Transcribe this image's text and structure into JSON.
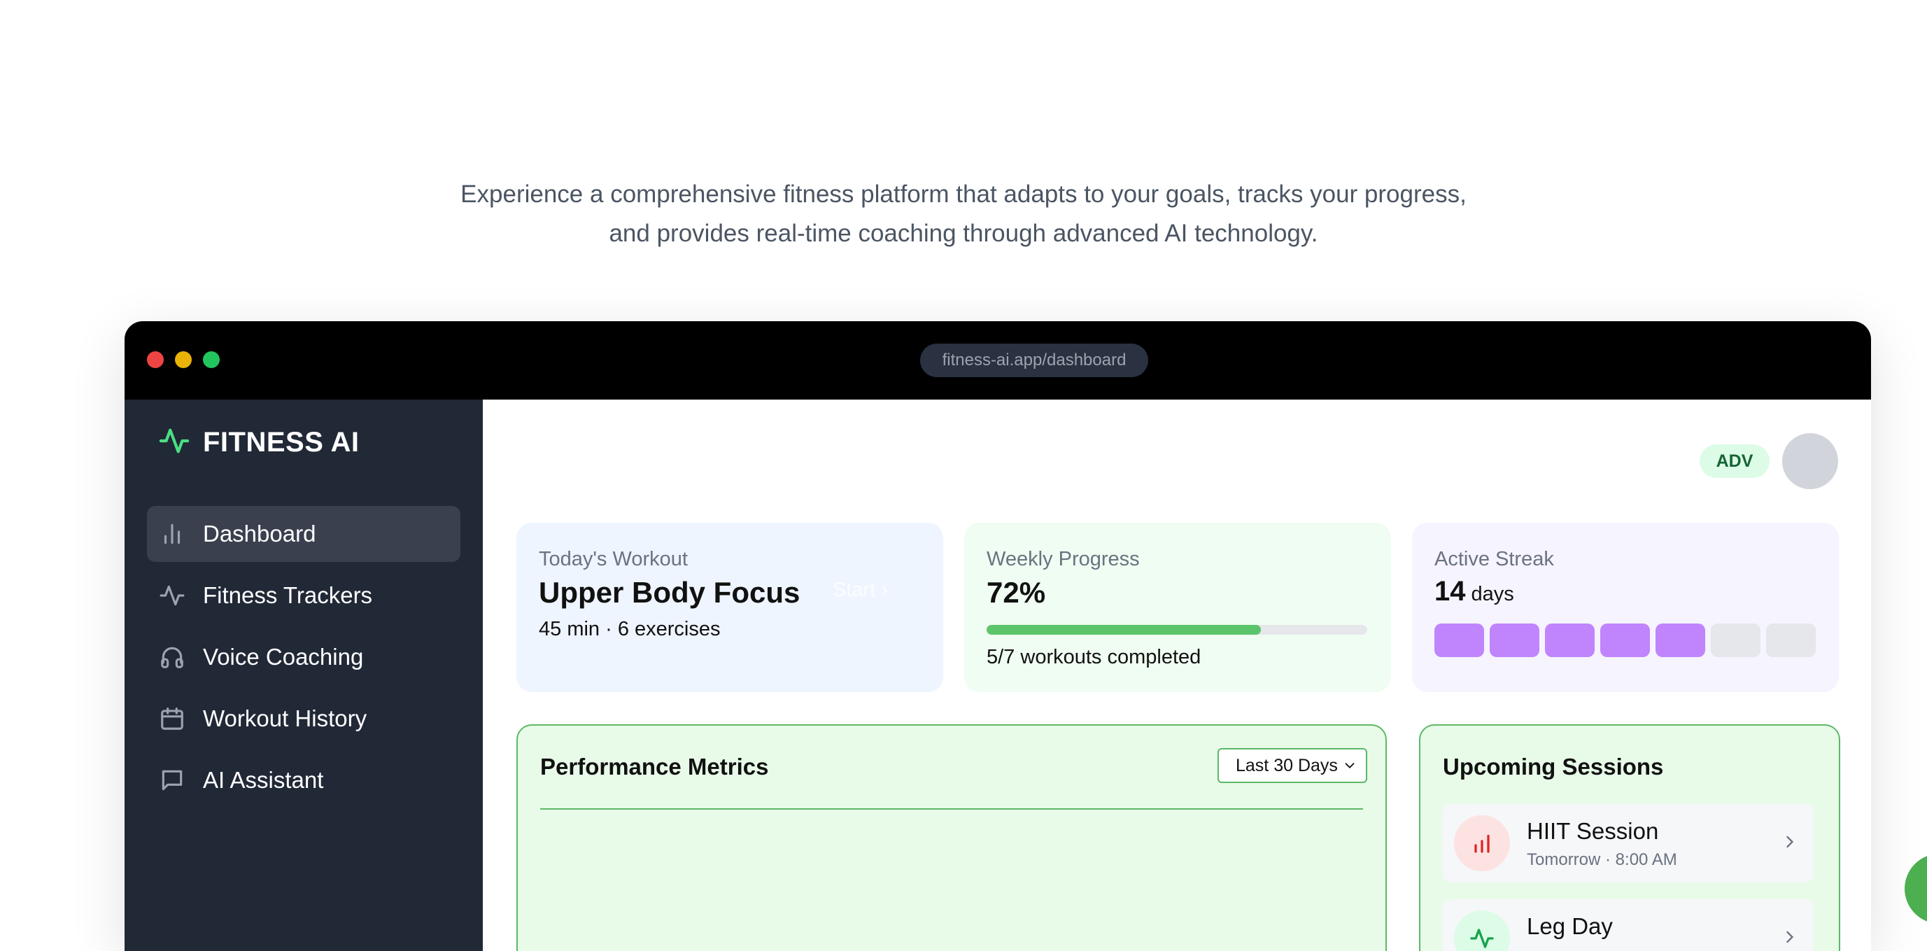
{
  "tagline": {
    "line1": "Experience a comprehensive fitness platform that adapts to your goals, tracks your progress,",
    "line2": "and provides real-time coaching through advanced AI technology."
  },
  "browser": {
    "url": "fitness-ai.app/dashboard"
  },
  "sidebar": {
    "brand": "FITNESS AI",
    "brand_icon": "activity-icon",
    "items": [
      {
        "label": "Dashboard",
        "icon": "bar-chart-icon",
        "active": true
      },
      {
        "label": "Fitness Trackers",
        "icon": "activity-icon",
        "active": false
      },
      {
        "label": "Voice Coaching",
        "icon": "headphones-icon",
        "active": false
      },
      {
        "label": "Workout History",
        "icon": "calendar-icon",
        "active": false
      },
      {
        "label": "AI Assistant",
        "icon": "message-icon",
        "active": false
      }
    ]
  },
  "header": {
    "level_badge": "ADV"
  },
  "cards": {
    "workout": {
      "label": "Today's Workout",
      "title": "Upper Body Focus",
      "detail": "45 min · 6 exercises",
      "action": "Start"
    },
    "progress": {
      "label": "Weekly Progress",
      "value": "72%",
      "percent": 72,
      "detail": "5/7 workouts completed"
    },
    "streak": {
      "label": "Active Streak",
      "count": "14",
      "unit": "days",
      "days_active": 5,
      "days_total": 7
    }
  },
  "performance": {
    "title": "Performance Metrics",
    "range": "Last 30 Days"
  },
  "upcoming": {
    "title": "Upcoming Sessions",
    "sessions": [
      {
        "name": "HIIT Session",
        "time": "Tomorrow · 8:00 AM",
        "icon": "bar-chart-icon"
      },
      {
        "name": "Leg Day",
        "time": "",
        "icon": "activity-icon"
      }
    ]
  },
  "colors": {
    "sidebar_bg": "#212836",
    "accent_green": "#5cc46a",
    "streak_purple": "#c084fc",
    "badge_green": "#166534"
  }
}
